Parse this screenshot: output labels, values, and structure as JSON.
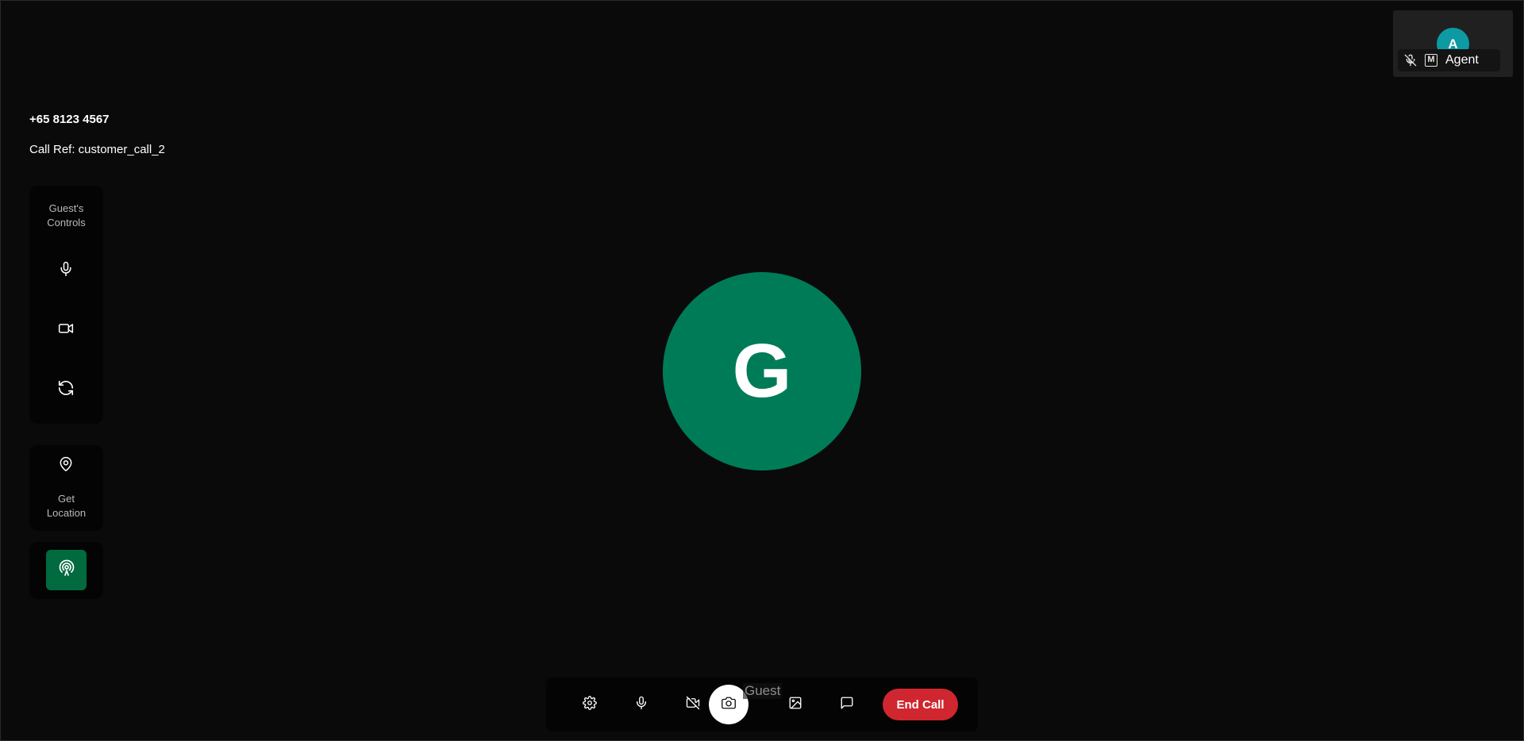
{
  "self_tile": {
    "avatar_initial": "A",
    "name": "Agent",
    "badge": "M",
    "mic_icon": "mic-off-icon"
  },
  "caller": {
    "phone": "+65 8123 4567",
    "call_ref": "Call Ref: customer_call_2"
  },
  "guest_controls": {
    "title_line1": "Guest's",
    "title_line2": "Controls",
    "buttons": [
      {
        "icon": "microphone-icon"
      },
      {
        "icon": "video-camera-icon"
      },
      {
        "icon": "switch-camera-icon"
      }
    ]
  },
  "location": {
    "label_line1": "Get",
    "label_line2": "Location",
    "icon": "map-pin-icon"
  },
  "broadcast": {
    "icon": "broadcast-icon"
  },
  "main": {
    "guest_initial": "G",
    "guest_label": "Guest"
  },
  "toolbar": {
    "buttons": [
      {
        "icon": "gear-icon"
      },
      {
        "icon": "microphone-icon"
      },
      {
        "icon": "video-off-icon"
      },
      {
        "icon": "camera-capture-icon"
      },
      {
        "icon": "image-icon"
      },
      {
        "icon": "chat-icon"
      }
    ],
    "end_call_label": "End Call"
  },
  "colors": {
    "background": "#0a0a0a",
    "guest_avatar": "#007b58",
    "self_avatar": "#0d9aa3",
    "broadcast_active": "#016a3e",
    "end_call": "#d0262f"
  }
}
